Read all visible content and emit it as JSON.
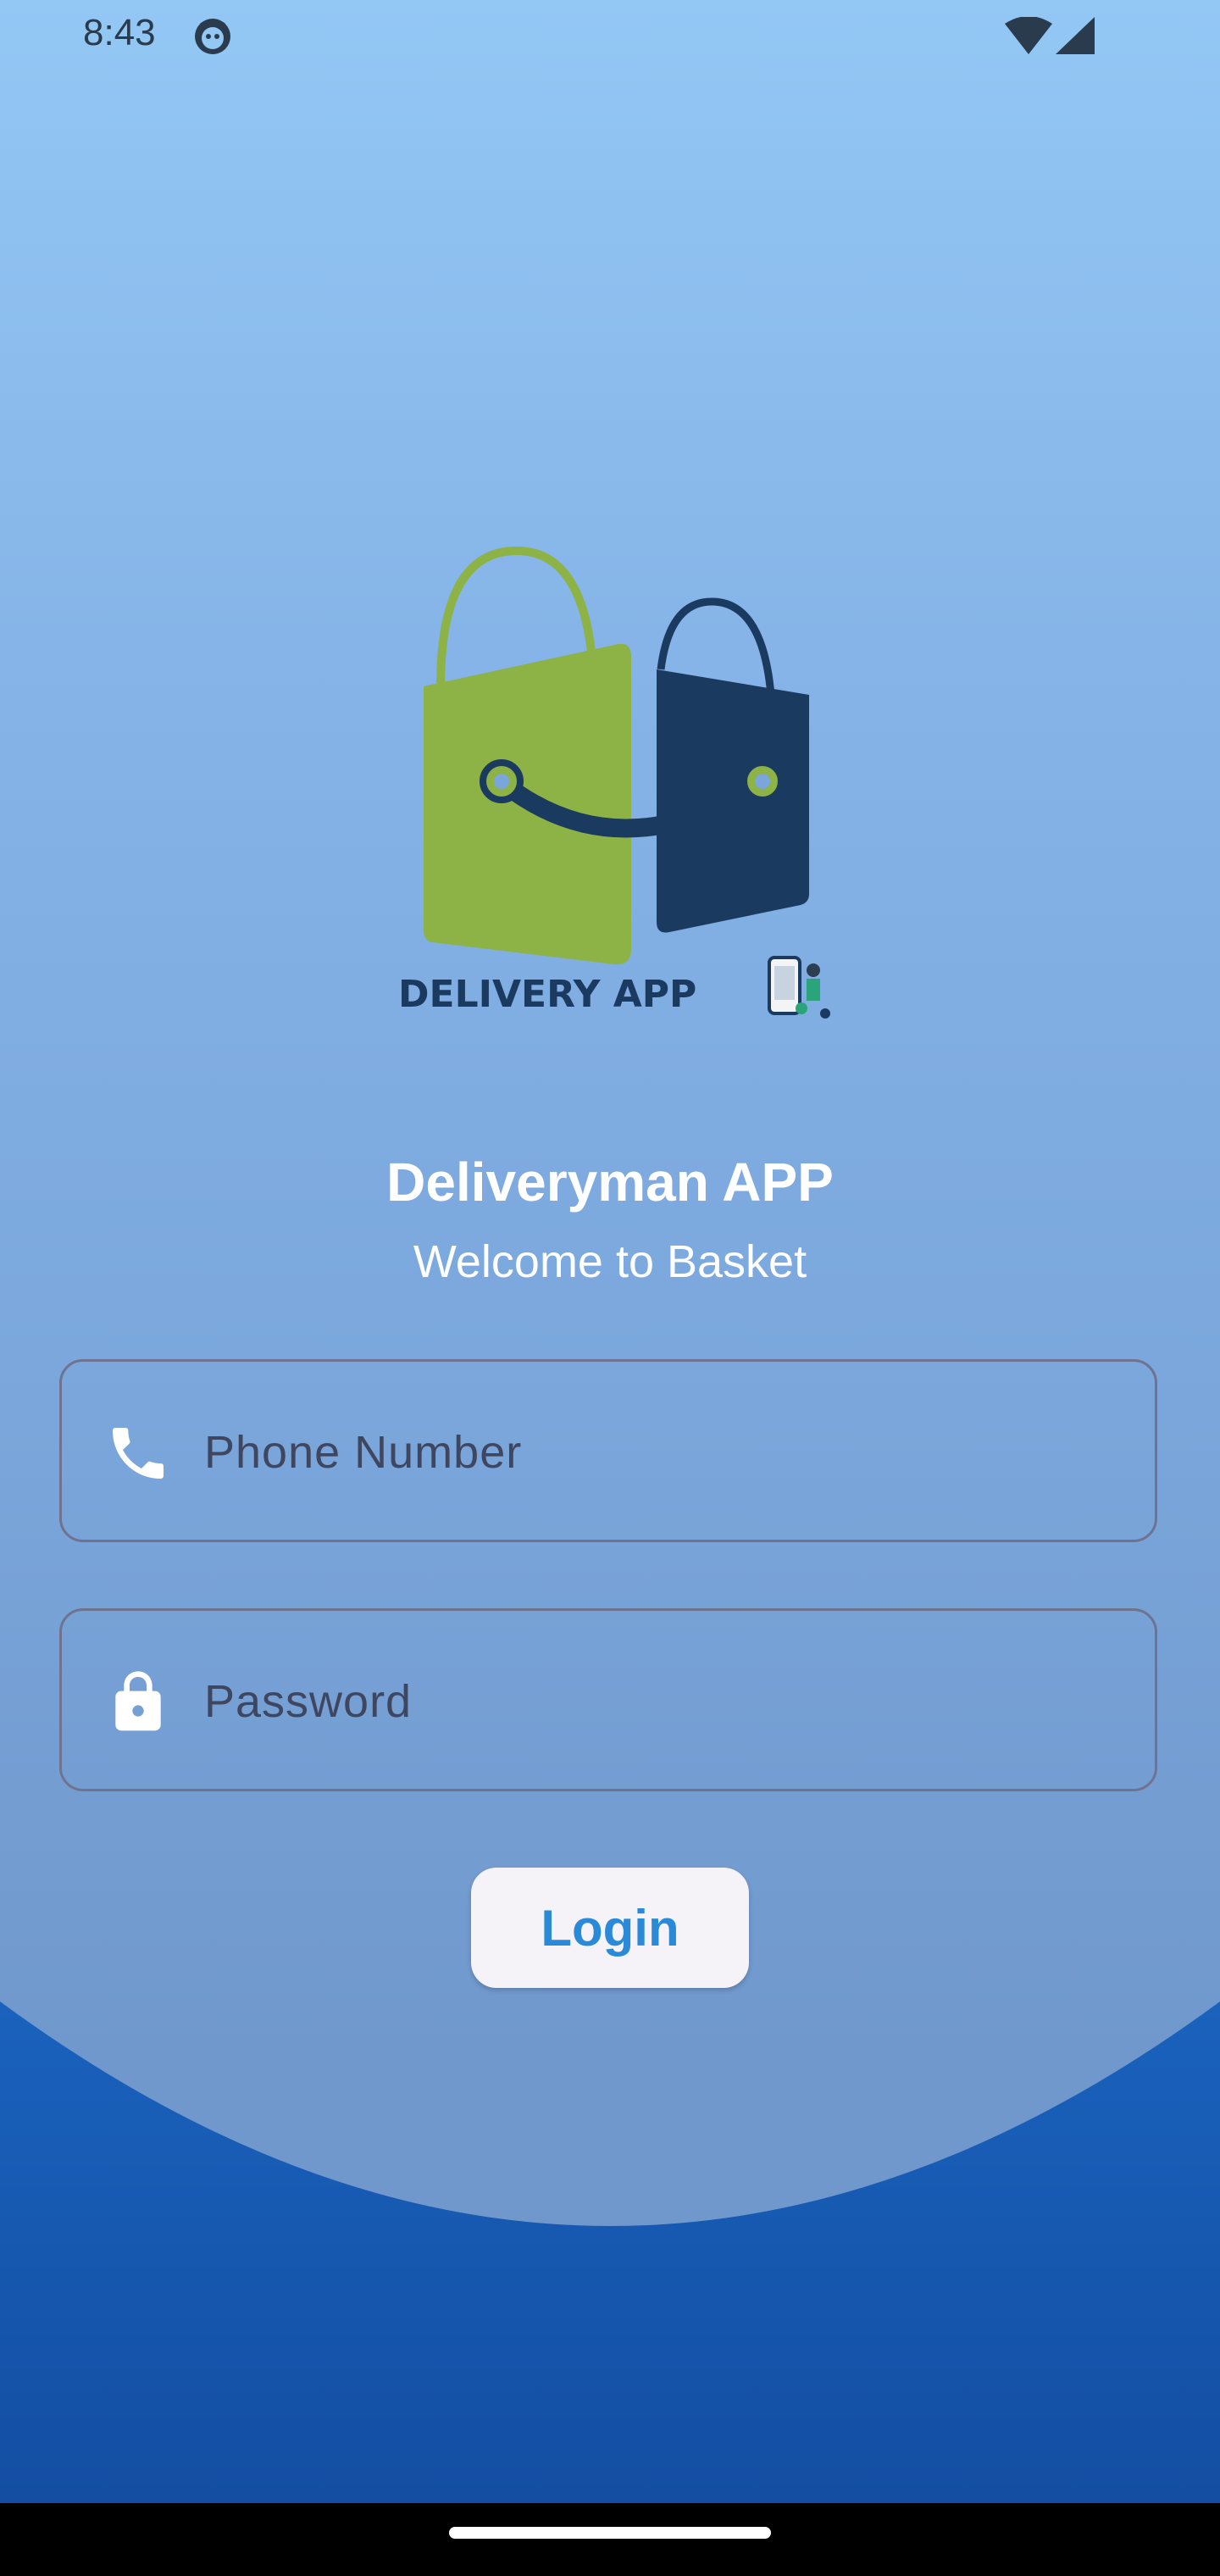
{
  "status_bar": {
    "time": "8:43",
    "app_icon": "android-notification-icon",
    "wifi_icon": "wifi-icon",
    "signal_icon": "cell-signal-icon"
  },
  "logo": {
    "text": "DELIVERY APP",
    "icon": "shopping-bags-logo",
    "colors": {
      "green_bag": "#8db246",
      "navy_bag": "#1b3a60"
    }
  },
  "header": {
    "title": "Deliveryman APP",
    "subtitle": "Welcome to Basket"
  },
  "form": {
    "phone": {
      "icon": "phone-icon",
      "placeholder": "Phone Number",
      "value": ""
    },
    "password": {
      "icon": "lock-icon",
      "placeholder": "Password",
      "value": ""
    },
    "login_label": "Login"
  },
  "theme": {
    "accent": "#2a8ad8",
    "wave_color": "#1553aa",
    "background_top": "#93c7f4"
  }
}
